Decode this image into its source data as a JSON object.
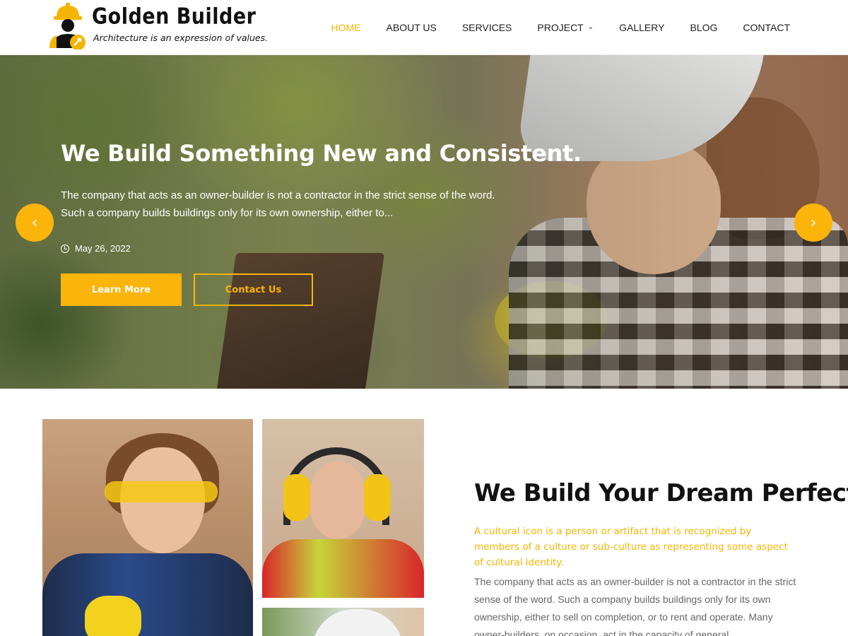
{
  "brand": {
    "name": "Golden Builder",
    "tagline": "Architecture is an expression of values.",
    "accent_color": "#fbb40a"
  },
  "nav": {
    "items": [
      {
        "label": "HOME",
        "active": true
      },
      {
        "label": "ABOUT US"
      },
      {
        "label": "SERVICES"
      },
      {
        "label": "PROJECT",
        "icon": "chevron-down-icon"
      },
      {
        "label": "GALLERY"
      },
      {
        "label": "BLOG"
      },
      {
        "label": "CONTACT"
      }
    ]
  },
  "hero": {
    "title": "We Build Something New and Consistent.",
    "text": "The company that acts as an owner-builder is not a contractor in the strict sense of the word. Such a company builds buildings only for its own ownership, either to...",
    "date": "May 26, 2022",
    "primary_button": "Learn More",
    "secondary_button": "Contact Us",
    "prev_icon": "‹",
    "next_icon": "›"
  },
  "about": {
    "title": "We Build Your Dream Perfectly",
    "subtitle": "A cultural icon is a person or artifact that is recognized by members of a culture or sub-culture as representing some aspect of cultural identity.",
    "body": "The company that acts as an owner-builder is not a contractor in the strict sense of the word. Such a company builds buildings only for its own ownership, either to sell on completion, or to rent and operate. Many owner-builders, on occasion, act in the capacity of general"
  }
}
